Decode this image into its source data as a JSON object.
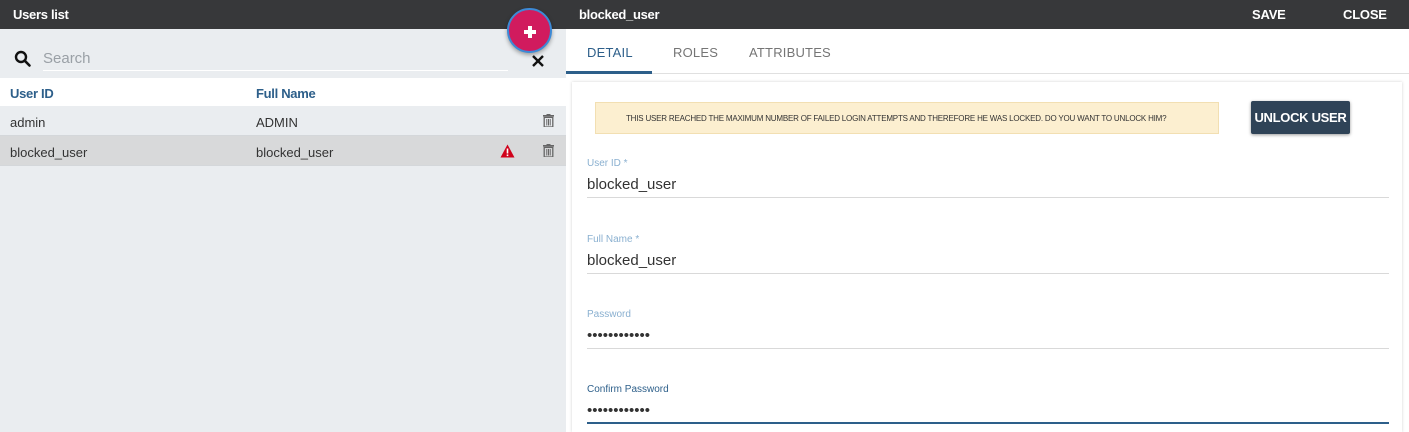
{
  "left_panel": {
    "title": "Users list",
    "search": {
      "placeholder": "Search",
      "value": ""
    },
    "columns": {
      "user_id": "User ID",
      "full_name": "Full Name"
    },
    "rows": [
      {
        "user_id": "admin",
        "full_name": "ADMIN",
        "warning": false
      },
      {
        "user_id": "blocked_user",
        "full_name": "blocked_user",
        "warning": true
      }
    ]
  },
  "right_panel": {
    "title": "blocked_user",
    "save_label": "SAVE",
    "close_label": "CLOSE",
    "tabs": [
      {
        "label": "DETAIL",
        "active": true
      },
      {
        "label": "ROLES",
        "active": false
      },
      {
        "label": "ATTRIBUTES",
        "active": false
      }
    ],
    "alert_text": "THIS USER REACHED THE MAXIMUM NUMBER OF FAILED LOGIN ATTEMPTS AND THEREFORE HE WAS LOCKED. DO YOU WANT TO UNLOCK HIM?",
    "unlock_label": "UNLOCK USER",
    "fields": {
      "user_id": {
        "label": "User ID *",
        "value": "blocked_user"
      },
      "full_name": {
        "label": "Full Name *",
        "value": "blocked_user"
      },
      "password": {
        "label": "Password",
        "value": "passwordpass"
      },
      "confirm_password": {
        "label": "Confirm Password",
        "value": "passwordpass"
      }
    }
  },
  "colors": {
    "top_bar": "#37383a",
    "accent": "#2d5f8a",
    "fab": "#d11b5e",
    "warning": "#d0021b",
    "alert_bg": "#fcefd0",
    "unlock_button": "#2f4357"
  },
  "icons": {
    "add": "plus-icon",
    "search": "search-icon",
    "clear": "close-icon",
    "delete": "trash-icon",
    "warning": "warning-icon"
  }
}
